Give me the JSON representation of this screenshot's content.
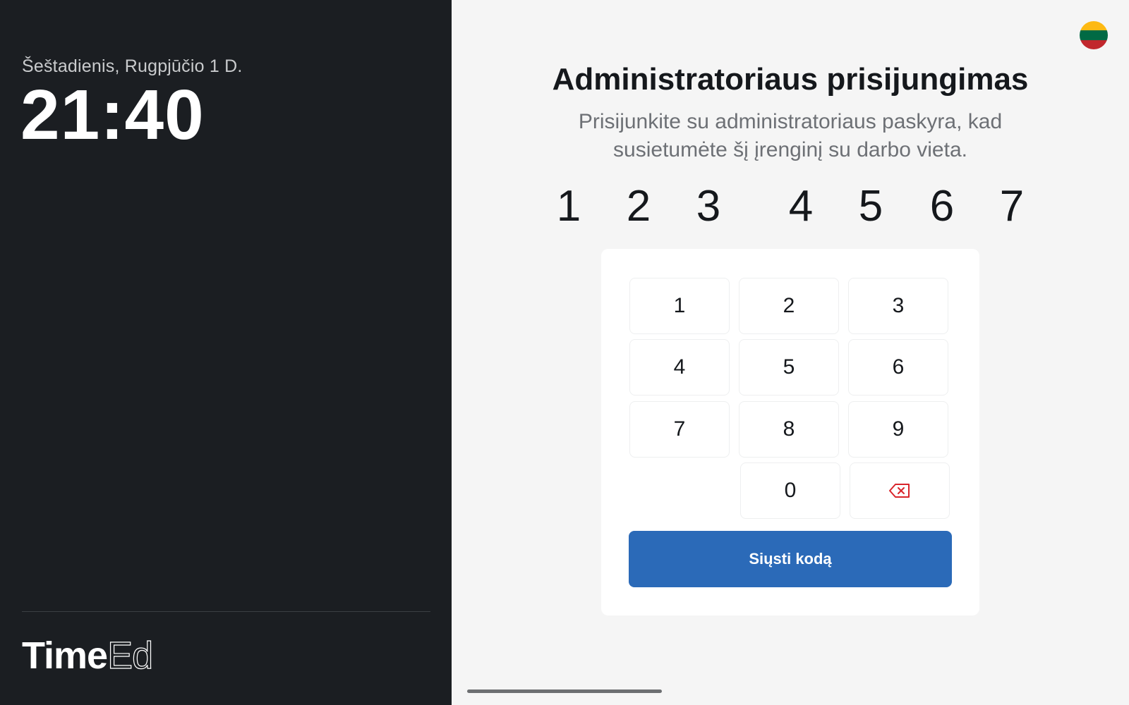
{
  "clock": {
    "date": "Šeštadienis, Rugpjūčio 1 D.",
    "time": "21:40"
  },
  "brand": {
    "logo_bold": "Time",
    "logo_thin": "Ed"
  },
  "language": {
    "flag_icon": "lithuania-flag-icon",
    "flag_colors": [
      "#fdb913",
      "#006a44",
      "#c1272d"
    ]
  },
  "login": {
    "title": "Administratoriaus prisijungimas",
    "subtitle": "Prisijunkite su administratoriaus paskyra, kad susietumėte šį įrenginį su darbo vieta.",
    "code_digits": [
      "1",
      "2",
      "3",
      "4",
      "5",
      "6",
      "7"
    ]
  },
  "keypad": {
    "keys": [
      "1",
      "2",
      "3",
      "4",
      "5",
      "6",
      "7",
      "8",
      "9",
      "0"
    ],
    "backspace_icon": "backspace-icon",
    "backspace_color": "#d9252b"
  },
  "submit": {
    "label": "Siųsti kodą",
    "color": "#2b6ab8"
  }
}
